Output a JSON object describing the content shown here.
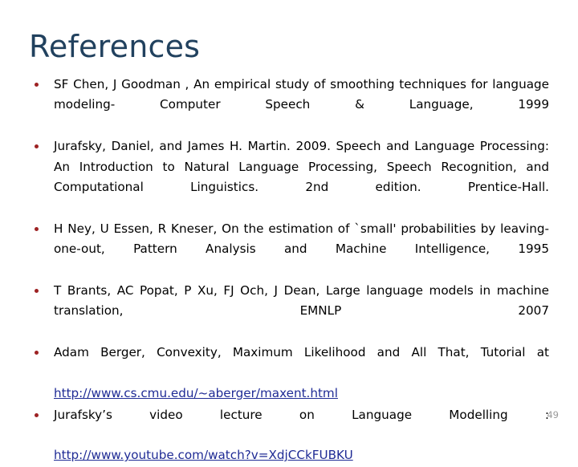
{
  "slide": {
    "title": "References",
    "page_number": "49",
    "title_color": "#21415e",
    "bullet_color": "#9d2223",
    "link_color": "#1f2b95",
    "background_color": "#ffffff",
    "references": [
      {
        "text": "SF Chen, J Goodman , An empirical study of smoothing techniques for language modeling- Computer Speech & Language, 1999",
        "link": null
      },
      {
        "text": "Jurafsky, Daniel, and James H. Martin. 2009. Speech and Language Processing: An Introduction to Natural Language Processing, Speech Recognition, and Computational Linguistics. 2nd edition. Prentice-Hall.",
        "link": null
      },
      {
        "text": "H Ney, U Essen, R Kneser, On the estimation of `small' probabilities by leaving-one-out, Pattern Analysis and Machine Intelligence, 1995",
        "link": null
      },
      {
        "text": "T Brants, AC Popat, P Xu, FJ Och, J Dean, Large language models in machine translation, EMNLP 2007",
        "link": null
      },
      {
        "text": "Adam Berger, Convexity, Maximum Likelihood and All That, Tutorial at",
        "link": "http://www.cs.cmu.edu/~aberger/maxent.html"
      },
      {
        "text": "Jurafsky’s      video       lecture      on      Language      Modelling      :",
        "link": "http://www.youtube.com/watch?v=XdjCCkFUBKU"
      }
    ]
  }
}
